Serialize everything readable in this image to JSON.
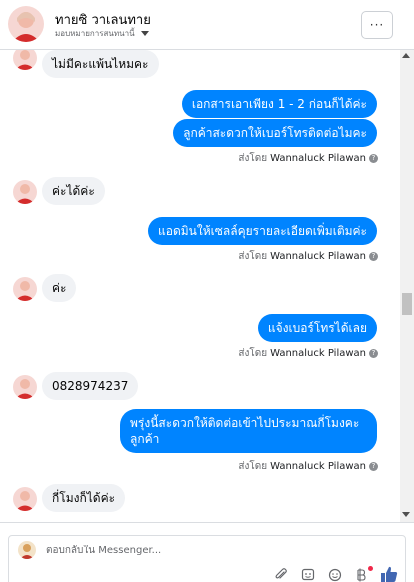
{
  "header": {
    "title": "ทายซิ วาเลนทาย",
    "subtitle": "มอบหมายการสนทนานี้",
    "more_label": "···"
  },
  "messages": [
    {
      "dir": "in",
      "text": "ไม่มีคะแพ้นไหมคะ"
    },
    {
      "dir": "out",
      "text": "เอกสารเอาเพียง 1 - 2 ก่อนก็ได้ค่ะ"
    },
    {
      "dir": "out",
      "text": "ลูกค้าสะดวกให้เบอร์โทรติดต่อไมคะ"
    },
    {
      "dir": "in",
      "text": "ค่ะได้ค่ะ"
    },
    {
      "dir": "out",
      "text": "แอดมินให้เซลล์คุยรายละเอียดเพิ่มเติมค่ะ"
    },
    {
      "dir": "in",
      "text": "ค่ะ"
    },
    {
      "dir": "out",
      "text": "แจ้งเบอร์โทรได้เลย"
    },
    {
      "dir": "in",
      "text": "0828974237"
    },
    {
      "dir": "out",
      "text": "พรุ่งนี้สะดวกให้ติดต่อเข้าไปประมาณกี่โมงคะ ลูกค้า"
    },
    {
      "dir": "in",
      "text": "กี่โมงก็ได้ค่ะ"
    }
  ],
  "sent_by": {
    "prefix": "ส่งโดย",
    "name": "Wannaluck Pilawan",
    "help": "?"
  },
  "composer": {
    "placeholder": "ตอบกลับใน Messenger..."
  },
  "icons": [
    "more-icon",
    "chevron-down-icon",
    "help-icon",
    "attach-icon",
    "sticker-icon",
    "emoji-icon",
    "payment-icon",
    "like-icon"
  ],
  "colors": {
    "outgoing_bubble": "#0084ff",
    "incoming_bubble": "#f0f2f5",
    "like_icon": "#4267b2",
    "notification_dot": "#f02849"
  }
}
